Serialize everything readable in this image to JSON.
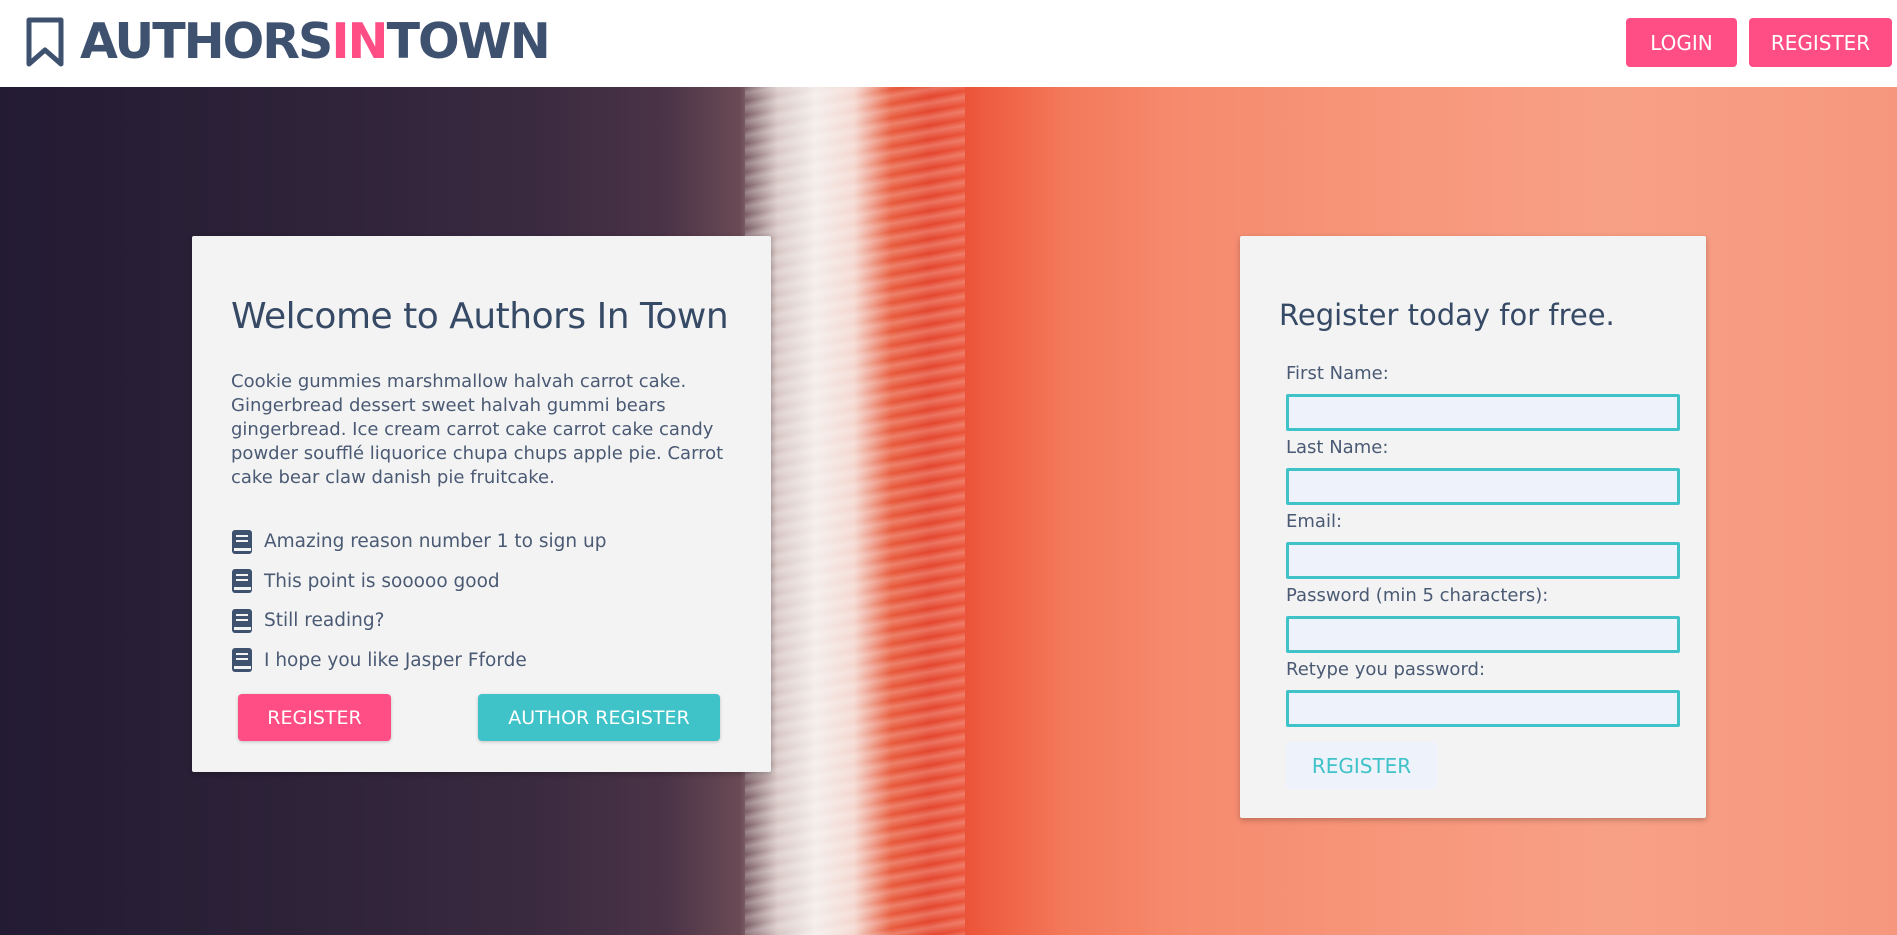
{
  "header": {
    "logo": {
      "part1": "AUTHORS",
      "part2": "IN",
      "part3": "TOWN",
      "icon": "bookmark-icon"
    },
    "login_label": "LOGIN",
    "register_label": "REGISTER"
  },
  "welcome": {
    "title": "Welcome to Authors In Town",
    "body": "Cookie gummies marshmallow halvah carrot cake. Gingerbread dessert sweet halvah gummi bears gingerbread. Ice cream carrot cake carrot cake candy powder soufflé liquorice chupa chups apple pie. Carrot cake bear claw danish pie fruitcake.",
    "features": [
      {
        "text": "Amazing reason number 1 to sign up",
        "icon": "book-icon"
      },
      {
        "text": "This point is sooooo good",
        "icon": "book-icon"
      },
      {
        "text": "Still reading?",
        "icon": "book-icon"
      },
      {
        "text": "I hope you like Jasper Fforde",
        "icon": "book-icon"
      }
    ],
    "register_label": "REGISTER",
    "author_register_label": "AUTHOR REGISTER"
  },
  "register_form": {
    "title": "Register today for free.",
    "fields": [
      {
        "label": "First Name:",
        "value": ""
      },
      {
        "label": "Last Name:",
        "value": ""
      },
      {
        "label": "Email:",
        "value": ""
      },
      {
        "label": "Password (min 5 characters):",
        "value": ""
      },
      {
        "label": "Retype you password:",
        "value": ""
      }
    ],
    "submit_label": "REGISTER"
  },
  "colors": {
    "accent_pink": "#ff4e86",
    "accent_teal": "#3fc2c8",
    "text_dark": "#364a66",
    "card_bg": "#f3f3f3",
    "input_bg": "#edf2fb"
  }
}
